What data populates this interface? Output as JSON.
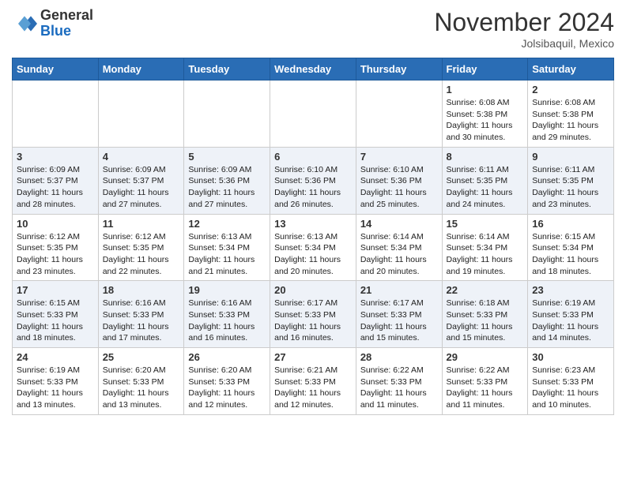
{
  "header": {
    "logo_general": "General",
    "logo_blue": "Blue",
    "month_title": "November 2024",
    "location": "Jolsibaquil, Mexico"
  },
  "weekdays": [
    "Sunday",
    "Monday",
    "Tuesday",
    "Wednesday",
    "Thursday",
    "Friday",
    "Saturday"
  ],
  "weeks": [
    [
      {
        "day": "",
        "info": ""
      },
      {
        "day": "",
        "info": ""
      },
      {
        "day": "",
        "info": ""
      },
      {
        "day": "",
        "info": ""
      },
      {
        "day": "",
        "info": ""
      },
      {
        "day": "1",
        "info": "Sunrise: 6:08 AM\nSunset: 5:38 PM\nDaylight: 11 hours\nand 30 minutes."
      },
      {
        "day": "2",
        "info": "Sunrise: 6:08 AM\nSunset: 5:38 PM\nDaylight: 11 hours\nand 29 minutes."
      }
    ],
    [
      {
        "day": "3",
        "info": "Sunrise: 6:09 AM\nSunset: 5:37 PM\nDaylight: 11 hours\nand 28 minutes."
      },
      {
        "day": "4",
        "info": "Sunrise: 6:09 AM\nSunset: 5:37 PM\nDaylight: 11 hours\nand 27 minutes."
      },
      {
        "day": "5",
        "info": "Sunrise: 6:09 AM\nSunset: 5:36 PM\nDaylight: 11 hours\nand 27 minutes."
      },
      {
        "day": "6",
        "info": "Sunrise: 6:10 AM\nSunset: 5:36 PM\nDaylight: 11 hours\nand 26 minutes."
      },
      {
        "day": "7",
        "info": "Sunrise: 6:10 AM\nSunset: 5:36 PM\nDaylight: 11 hours\nand 25 minutes."
      },
      {
        "day": "8",
        "info": "Sunrise: 6:11 AM\nSunset: 5:35 PM\nDaylight: 11 hours\nand 24 minutes."
      },
      {
        "day": "9",
        "info": "Sunrise: 6:11 AM\nSunset: 5:35 PM\nDaylight: 11 hours\nand 23 minutes."
      }
    ],
    [
      {
        "day": "10",
        "info": "Sunrise: 6:12 AM\nSunset: 5:35 PM\nDaylight: 11 hours\nand 23 minutes."
      },
      {
        "day": "11",
        "info": "Sunrise: 6:12 AM\nSunset: 5:35 PM\nDaylight: 11 hours\nand 22 minutes."
      },
      {
        "day": "12",
        "info": "Sunrise: 6:13 AM\nSunset: 5:34 PM\nDaylight: 11 hours\nand 21 minutes."
      },
      {
        "day": "13",
        "info": "Sunrise: 6:13 AM\nSunset: 5:34 PM\nDaylight: 11 hours\nand 20 minutes."
      },
      {
        "day": "14",
        "info": "Sunrise: 6:14 AM\nSunset: 5:34 PM\nDaylight: 11 hours\nand 20 minutes."
      },
      {
        "day": "15",
        "info": "Sunrise: 6:14 AM\nSunset: 5:34 PM\nDaylight: 11 hours\nand 19 minutes."
      },
      {
        "day": "16",
        "info": "Sunrise: 6:15 AM\nSunset: 5:34 PM\nDaylight: 11 hours\nand 18 minutes."
      }
    ],
    [
      {
        "day": "17",
        "info": "Sunrise: 6:15 AM\nSunset: 5:33 PM\nDaylight: 11 hours\nand 18 minutes."
      },
      {
        "day": "18",
        "info": "Sunrise: 6:16 AM\nSunset: 5:33 PM\nDaylight: 11 hours\nand 17 minutes."
      },
      {
        "day": "19",
        "info": "Sunrise: 6:16 AM\nSunset: 5:33 PM\nDaylight: 11 hours\nand 16 minutes."
      },
      {
        "day": "20",
        "info": "Sunrise: 6:17 AM\nSunset: 5:33 PM\nDaylight: 11 hours\nand 16 minutes."
      },
      {
        "day": "21",
        "info": "Sunrise: 6:17 AM\nSunset: 5:33 PM\nDaylight: 11 hours\nand 15 minutes."
      },
      {
        "day": "22",
        "info": "Sunrise: 6:18 AM\nSunset: 5:33 PM\nDaylight: 11 hours\nand 15 minutes."
      },
      {
        "day": "23",
        "info": "Sunrise: 6:19 AM\nSunset: 5:33 PM\nDaylight: 11 hours\nand 14 minutes."
      }
    ],
    [
      {
        "day": "24",
        "info": "Sunrise: 6:19 AM\nSunset: 5:33 PM\nDaylight: 11 hours\nand 13 minutes."
      },
      {
        "day": "25",
        "info": "Sunrise: 6:20 AM\nSunset: 5:33 PM\nDaylight: 11 hours\nand 13 minutes."
      },
      {
        "day": "26",
        "info": "Sunrise: 6:20 AM\nSunset: 5:33 PM\nDaylight: 11 hours\nand 12 minutes."
      },
      {
        "day": "27",
        "info": "Sunrise: 6:21 AM\nSunset: 5:33 PM\nDaylight: 11 hours\nand 12 minutes."
      },
      {
        "day": "28",
        "info": "Sunrise: 6:22 AM\nSunset: 5:33 PM\nDaylight: 11 hours\nand 11 minutes."
      },
      {
        "day": "29",
        "info": "Sunrise: 6:22 AM\nSunset: 5:33 PM\nDaylight: 11 hours\nand 11 minutes."
      },
      {
        "day": "30",
        "info": "Sunrise: 6:23 AM\nSunset: 5:33 PM\nDaylight: 11 hours\nand 10 minutes."
      }
    ]
  ]
}
